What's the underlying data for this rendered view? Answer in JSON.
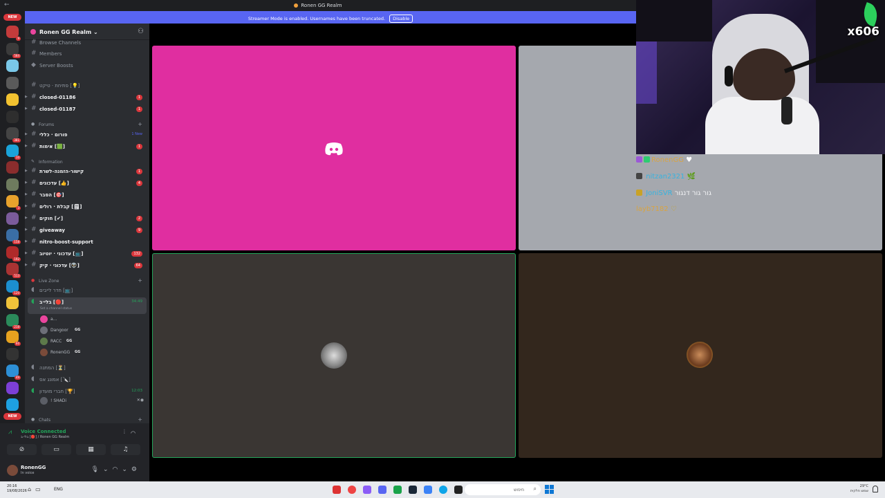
{
  "window": {
    "title": "Ronen GG Realm"
  },
  "banner": {
    "text": "Streamer Mode is enabled. Usernames have been truncated.",
    "disable_label": "Disable"
  },
  "rail": {
    "new_top": "NEW",
    "new_bottom": "NEW",
    "servers": [
      {
        "color": "#c43b3b",
        "count": "9"
      },
      {
        "color": "#3b3b3b",
        "count": "584"
      },
      {
        "color": "#7ac8e8",
        "count": ""
      },
      {
        "color": "#5a5a5a",
        "count": ""
      },
      {
        "color": "#f2c230",
        "count": ""
      },
      {
        "color": "#2e2e2e",
        "count": ""
      },
      {
        "color": "#444",
        "count": "381"
      },
      {
        "color": "#1aa3d9",
        "count": "10"
      },
      {
        "color": "#8a2d2d",
        "count": ""
      },
      {
        "color": "#6e7b5e",
        "count": ""
      },
      {
        "color": "#e8a22c",
        "count": "3"
      },
      {
        "color": "#7b5b9b",
        "count": ""
      },
      {
        "color": "#3a6ea5",
        "count": "158"
      },
      {
        "color": "#b02a2a",
        "count": "192"
      },
      {
        "color": "#a33",
        "count": "513"
      },
      {
        "color": "#1c8fcf",
        "count": "120"
      },
      {
        "color": "#f0c23a",
        "count": ""
      },
      {
        "color": "#2b8a5a",
        "count": "218"
      },
      {
        "color": "#e6a21f",
        "count": "60"
      },
      {
        "color": "#333",
        "count": ""
      },
      {
        "color": "#2d8fd6",
        "count": "49"
      },
      {
        "color": "#7c3fd6",
        "count": ""
      },
      {
        "color": "#1ea0e0",
        "count": ""
      }
    ]
  },
  "guild": {
    "name": "Ronen GG Realm"
  },
  "top_items": [
    {
      "icon": "#",
      "name": "Browse Channels"
    },
    {
      "icon": "#",
      "name": "Members"
    },
    {
      "icon": "◆",
      "name": "Server Boosts"
    }
  ],
  "channels_a": [
    {
      "name": "פתיחת · טיקט [💡]",
      "muted": true,
      "badge": ""
    },
    {
      "name": "closed-01186",
      "muted": false,
      "badge": "1"
    },
    {
      "name": "closed-01187",
      "muted": false,
      "badge": "1"
    }
  ],
  "cat_forums": "Forums",
  "forums": [
    {
      "name": "פורום · כללי",
      "badge": "",
      "newtag": "1 New"
    },
    {
      "name": "אימות [🟩]",
      "badge": "1",
      "newtag": ""
    }
  ],
  "cat_information": "Information",
  "info_channels": [
    {
      "name": "קישור-הזמנה-לשרת",
      "badge": "1"
    },
    {
      "name": "עדכונים [👍]",
      "badge": "4"
    },
    {
      "name": "הסבר [🎯]",
      "badge": ""
    },
    {
      "name": "קבלת · רולים [🗒]",
      "badge": ""
    },
    {
      "name": "חוקים [✔]",
      "badge": "2"
    },
    {
      "name": "giveaway",
      "badge": "9"
    },
    {
      "name": "nitro-boost-support",
      "badge": ""
    },
    {
      "name": "עדכוני · יוטיוב [📺]",
      "badge": "132"
    },
    {
      "name": "עדכוני · קיק [👽]",
      "badge": "64"
    }
  ],
  "cat_live": "Live Zone",
  "live": {
    "lobby": "חדר לייבים [📺]",
    "active_channel": "בלי·ב [🔴]",
    "active_time": "34:49",
    "status_hint": "Set a channel status",
    "users": [
      {
        "name": "a...",
        "tag": "",
        "color": "#eb459e"
      },
      {
        "name": "Dangoor",
        "tag": "GG",
        "color": "#6d6f78"
      },
      {
        "name": "RACC",
        "tag": "GG",
        "color": "#5d7a4a"
      },
      {
        "name": "RonenGG",
        "tag": "GG",
        "color": "#7a4b3a"
      }
    ],
    "ch_waiting": "המתנה [⏳]",
    "ch_training": "אמונג אס [🔪]",
    "ch_friends": "חברי מועדון [🏆]",
    "friends_time": "12:03",
    "friends_user": "! SHADi"
  },
  "cat_chats": "Chats",
  "voice": {
    "status": "Voice Connected",
    "location": "בלי·ב [🔴] / Ronen GG Realm"
  },
  "user": {
    "name": "RonenGG",
    "status": "In voice"
  },
  "overlay": {
    "tag": "x606"
  },
  "chat": [
    {
      "user": "RonenGG",
      "color": "#d9a441",
      "msg": "♥"
    },
    {
      "user": "nitzan2321",
      "color": "#36b3e0",
      "msg": "🌿"
    },
    {
      "user": "JoniSVR",
      "color": "#36b3e0",
      "msg": "גור גור דנגור"
    },
    {
      "user": "layb7182",
      "color": "#d9a441",
      "msg": "♡"
    }
  ],
  "taskbar": {
    "time": "20:16",
    "date": "19/08/2026",
    "lang": "ENG",
    "search_placeholder": "חיפוש",
    "weather_temp": "29°C",
    "weather_desc": "שמש חלקית"
  }
}
